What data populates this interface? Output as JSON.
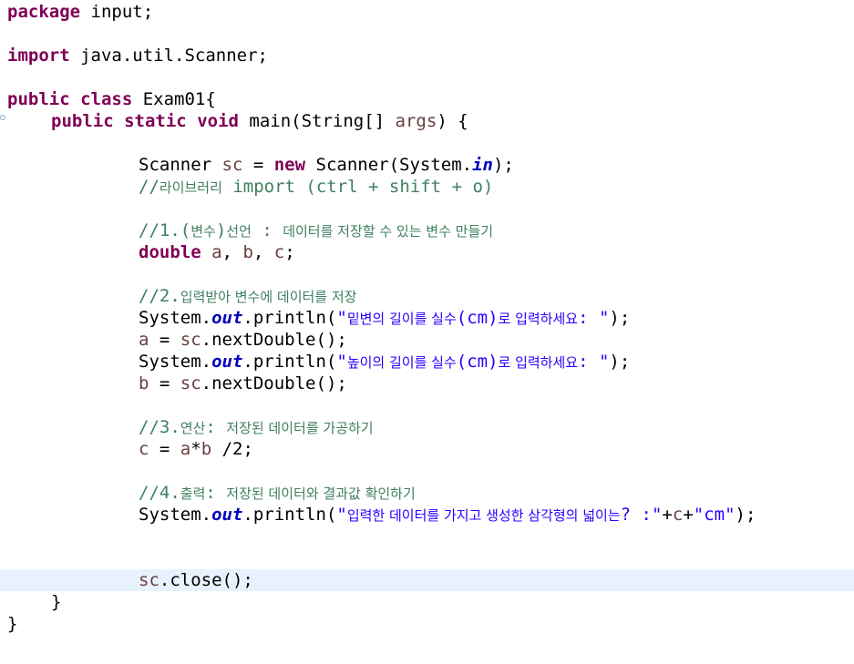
{
  "lines": [
    {
      "indent": 0,
      "tokens": [
        {
          "t": "kw",
          "v": "package"
        },
        {
          "t": "p",
          "v": " input;"
        }
      ]
    },
    {
      "indent": 0,
      "tokens": []
    },
    {
      "indent": 0,
      "tokens": [
        {
          "t": "kw",
          "v": "import"
        },
        {
          "t": "p",
          "v": " java.util.Scanner;"
        }
      ]
    },
    {
      "indent": 0,
      "tokens": []
    },
    {
      "indent": 0,
      "tokens": [
        {
          "t": "kw",
          "v": "public"
        },
        {
          "t": "p",
          "v": " "
        },
        {
          "t": "kw",
          "v": "class"
        },
        {
          "t": "p",
          "v": " Exam01{"
        }
      ]
    },
    {
      "indent": 4,
      "tokens": [
        {
          "t": "kw",
          "v": "public"
        },
        {
          "t": "p",
          "v": " "
        },
        {
          "t": "kw",
          "v": "static"
        },
        {
          "t": "p",
          "v": " "
        },
        {
          "t": "kw",
          "v": "void"
        },
        {
          "t": "p",
          "v": " main(String[] "
        },
        {
          "t": "var",
          "v": "args"
        },
        {
          "t": "p",
          "v": ") {"
        }
      ]
    },
    {
      "indent": 0,
      "tokens": []
    },
    {
      "indent": 12,
      "tokens": [
        {
          "t": "p",
          "v": "Scanner "
        },
        {
          "t": "var",
          "v": "sc"
        },
        {
          "t": "p",
          "v": " = "
        },
        {
          "t": "kw",
          "v": "new"
        },
        {
          "t": "p",
          "v": " Scanner(System."
        },
        {
          "t": "field",
          "v": "in"
        },
        {
          "t": "p",
          "v": ");"
        }
      ]
    },
    {
      "indent": 12,
      "tokens": [
        {
          "t": "cm",
          "v": "//"
        },
        {
          "t": "cmko",
          "v": "라이브러리"
        },
        {
          "t": "cm",
          "v": " import (ctrl + shift + o)"
        }
      ]
    },
    {
      "indent": 0,
      "tokens": []
    },
    {
      "indent": 12,
      "tokens": [
        {
          "t": "cm",
          "v": "//1.("
        },
        {
          "t": "cmko",
          "v": "변수"
        },
        {
          "t": "cm",
          "v": ")"
        },
        {
          "t": "cmko",
          "v": "선언"
        },
        {
          "t": "cm",
          "v": " : "
        },
        {
          "t": "cmko",
          "v": "데이터를 저장할 수 있는 변수 만들기"
        }
      ]
    },
    {
      "indent": 12,
      "tokens": [
        {
          "t": "kw",
          "v": "double"
        },
        {
          "t": "p",
          "v": " "
        },
        {
          "t": "var",
          "v": "a"
        },
        {
          "t": "p",
          "v": ", "
        },
        {
          "t": "var",
          "v": "b"
        },
        {
          "t": "p",
          "v": ", "
        },
        {
          "t": "var",
          "v": "c"
        },
        {
          "t": "p",
          "v": ";"
        }
      ]
    },
    {
      "indent": 0,
      "tokens": []
    },
    {
      "indent": 12,
      "tokens": [
        {
          "t": "cm",
          "v": "//2."
        },
        {
          "t": "cmko",
          "v": "입력받아 변수에 데이터를 저장"
        }
      ]
    },
    {
      "indent": 12,
      "tokens": [
        {
          "t": "p",
          "v": "System."
        },
        {
          "t": "field",
          "v": "out"
        },
        {
          "t": "p",
          "v": ".println("
        },
        {
          "t": "str",
          "v": "\""
        },
        {
          "t": "strko",
          "v": "밑변의 길이를 실수"
        },
        {
          "t": "str",
          "v": "(cm)"
        },
        {
          "t": "strko",
          "v": "로 입력하세요"
        },
        {
          "t": "str",
          "v": ": \""
        },
        {
          "t": "p",
          "v": ");"
        }
      ]
    },
    {
      "indent": 12,
      "tokens": [
        {
          "t": "var",
          "v": "a"
        },
        {
          "t": "p",
          "v": " = "
        },
        {
          "t": "var",
          "v": "sc"
        },
        {
          "t": "p",
          "v": ".nextDouble();"
        }
      ]
    },
    {
      "indent": 12,
      "tokens": [
        {
          "t": "p",
          "v": "System."
        },
        {
          "t": "field",
          "v": "out"
        },
        {
          "t": "p",
          "v": ".println("
        },
        {
          "t": "str",
          "v": "\""
        },
        {
          "t": "strko",
          "v": "높이의 길이를 실수"
        },
        {
          "t": "str",
          "v": "(cm)"
        },
        {
          "t": "strko",
          "v": "로 입력하세요"
        },
        {
          "t": "str",
          "v": ": \""
        },
        {
          "t": "p",
          "v": ");"
        }
      ]
    },
    {
      "indent": 12,
      "tokens": [
        {
          "t": "var",
          "v": "b"
        },
        {
          "t": "p",
          "v": " = "
        },
        {
          "t": "var",
          "v": "sc"
        },
        {
          "t": "p",
          "v": ".nextDouble();"
        }
      ]
    },
    {
      "indent": 0,
      "tokens": []
    },
    {
      "indent": 12,
      "tokens": [
        {
          "t": "cm",
          "v": "//3."
        },
        {
          "t": "cmko",
          "v": "연산"
        },
        {
          "t": "cm",
          "v": ": "
        },
        {
          "t": "cmko",
          "v": "저장된 데이터를 가공하기"
        }
      ]
    },
    {
      "indent": 12,
      "tokens": [
        {
          "t": "var",
          "v": "c"
        },
        {
          "t": "p",
          "v": " = "
        },
        {
          "t": "var",
          "v": "a"
        },
        {
          "t": "p",
          "v": "*"
        },
        {
          "t": "var",
          "v": "b"
        },
        {
          "t": "p",
          "v": " /2;"
        }
      ]
    },
    {
      "indent": 0,
      "tokens": []
    },
    {
      "indent": 12,
      "tokens": [
        {
          "t": "cm",
          "v": "//4."
        },
        {
          "t": "cmko",
          "v": "출력"
        },
        {
          "t": "cm",
          "v": ": "
        },
        {
          "t": "cmko",
          "v": "저장된 데이터와 결과값 확인하기"
        }
      ]
    },
    {
      "indent": 12,
      "tokens": [
        {
          "t": "p",
          "v": "System."
        },
        {
          "t": "field",
          "v": "out"
        },
        {
          "t": "p",
          "v": ".println("
        },
        {
          "t": "str",
          "v": "\""
        },
        {
          "t": "strko",
          "v": "입력한 데이터를 가지고 생성한 삼각형의 넓이는"
        },
        {
          "t": "str",
          "v": "? :\""
        },
        {
          "t": "p",
          "v": "+"
        },
        {
          "t": "var",
          "v": "c"
        },
        {
          "t": "p",
          "v": "+"
        },
        {
          "t": "str",
          "v": "\"cm\""
        },
        {
          "t": "p",
          "v": ");"
        }
      ]
    },
    {
      "indent": 0,
      "tokens": []
    },
    {
      "indent": 0,
      "tokens": []
    },
    {
      "indent": 12,
      "current": true,
      "tokens": [
        {
          "t": "var",
          "v": "sc"
        },
        {
          "t": "p",
          "v": ".close();"
        }
      ]
    },
    {
      "indent": 4,
      "tokens": [
        {
          "t": "p",
          "v": "}"
        }
      ]
    },
    {
      "indent": 0,
      "tokens": [
        {
          "t": "p",
          "v": "}"
        }
      ]
    }
  ],
  "colors": {
    "keyword": "#7f0055",
    "local_variable": "#6a3e3e",
    "string": "#2a00ff",
    "comment": "#3f7f5f",
    "static_field": "#0000c0",
    "current_line": "#e8f2fe"
  }
}
